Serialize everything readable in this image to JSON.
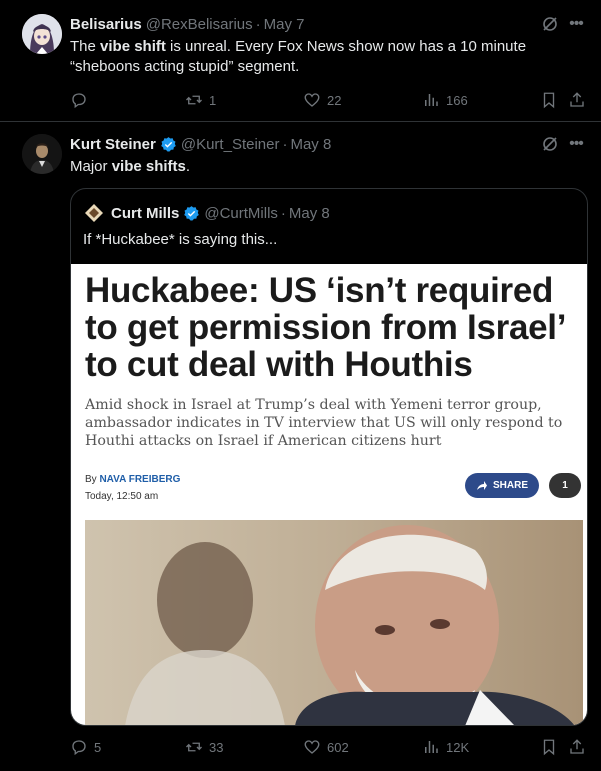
{
  "tweet1": {
    "name": "Belisarius",
    "handle": "@RexBelisarius",
    "sep": "·",
    "date": "May 7",
    "text_a": "The ",
    "text_bold1": "vibe shift",
    "text_b": " is unreal. Every Fox News show now has a 10 minute",
    "text_c": "“sheboons acting stupid” segment.",
    "replies": "",
    "retweets": "1",
    "likes": "22",
    "views": "166"
  },
  "tweet2": {
    "name": "Kurt Steiner",
    "handle": "@Kurt_Steiner",
    "sep": "·",
    "date": "May 8",
    "text_a": "Major ",
    "text_bold": "vibe shifts",
    "text_b": ".",
    "replies": "5",
    "retweets": "33",
    "likes": "602",
    "views": "12K",
    "quote": {
      "name": "Curt Mills",
      "handle": "@CurtMills",
      "sep": "·",
      "date": "May 8",
      "text": "If *Huckabee* is saying this...",
      "article": {
        "headline": "Huckabee: US ‘isn’t required to get permission from Israel’ to cut deal with Houthis",
        "deck": "Amid shock in Israel at Trump’s deal with Yemeni terror group, ambassador indicates in TV interview that US will only respond to Houthi attacks on Israel if American citizens hurt",
        "by": "By ",
        "author": "NAVA FREIBERG",
        "date": "Today, 12:50 am",
        "share": "SHARE",
        "comments": "1"
      }
    }
  },
  "colors": {
    "background": "#000000",
    "text": "#e7e9ea",
    "muted": "#71767b",
    "verified": "#1d9bf0",
    "border": "#2f3336"
  }
}
